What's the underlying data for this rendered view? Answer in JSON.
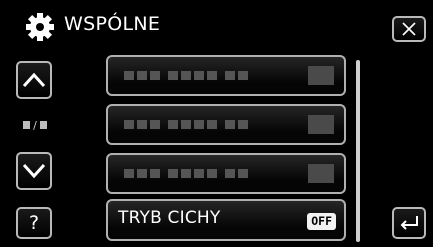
{
  "header": {
    "title": "WSPÓLNE",
    "icon": "gear-icon"
  },
  "nav": {
    "up_icon": "chevron-up-icon",
    "down_icon": "chevron-down-icon",
    "help_label": "?",
    "close_icon": "close-icon",
    "back_icon": "return-icon"
  },
  "menu": {
    "items": [
      {
        "label": "",
        "value": "",
        "obscured": true
      },
      {
        "label": "",
        "value": "",
        "obscured": true
      },
      {
        "label": "",
        "value": "",
        "obscured": true
      },
      {
        "label": "TRYB CICHY",
        "value": "OFF",
        "obscured": false
      }
    ]
  },
  "colors": {
    "background": "#000000",
    "border": "#b9b9b9",
    "text": "#ffffff"
  }
}
